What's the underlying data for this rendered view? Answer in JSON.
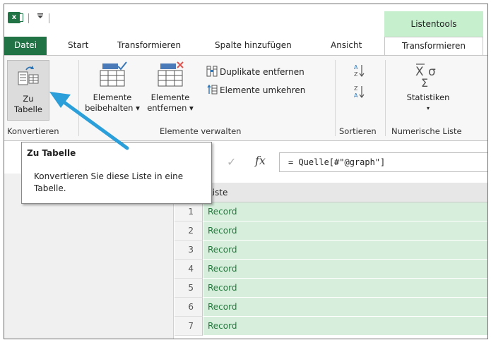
{
  "titlebar": {
    "app_icon": "excel-icon",
    "qat_button": "customize-qat-icon",
    "context_tab_label": "Listentools"
  },
  "tabs": [
    {
      "label": "Datei"
    },
    {
      "label": "Start"
    },
    {
      "label": "Transformieren"
    },
    {
      "label": "Spalte hinzufügen"
    },
    {
      "label": "Ansicht"
    },
    {
      "label": "Transformieren"
    }
  ],
  "ribbon": {
    "konvertieren": {
      "zu_tabelle_line1": "Zu",
      "zu_tabelle_line2": "Tabelle",
      "group_label": "Konvertieren"
    },
    "elemente_verwalten": {
      "beibehalten_line1": "Elemente",
      "beibehalten_line2": "beibehalten ▾",
      "entfernen_line1": "Elemente",
      "entfernen_line2": "entfernen ▾",
      "duplikate": "Duplikate entfernen",
      "umkehren": "Elemente umkehren",
      "group_label": "Elemente verwalten"
    },
    "sortieren": {
      "group_label": "Sortieren"
    },
    "numerische_liste": {
      "statistiken_label": "Statistiken",
      "statistiken_caret": "▾",
      "group_label": "Numerische Liste"
    }
  },
  "formula": {
    "check_symbol": "✓",
    "fx_symbol": "fx",
    "expression": "= Quelle[#\"@graph\"]"
  },
  "grid": {
    "column_header": "Liste",
    "rows": [
      {
        "num": "1",
        "value": "Record"
      },
      {
        "num": "2",
        "value": "Record"
      },
      {
        "num": "3",
        "value": "Record"
      },
      {
        "num": "4",
        "value": "Record"
      },
      {
        "num": "5",
        "value": "Record"
      },
      {
        "num": "6",
        "value": "Record"
      },
      {
        "num": "7",
        "value": "Record"
      }
    ]
  },
  "tooltip": {
    "title": "Zu Tabelle",
    "body": "Konvertieren Sie diese Liste in eine Tabelle."
  },
  "colors": {
    "excel_green": "#217346",
    "context_green": "#c6efce",
    "row_green": "#d7eedc",
    "arrow_blue": "#2b9fd9"
  }
}
